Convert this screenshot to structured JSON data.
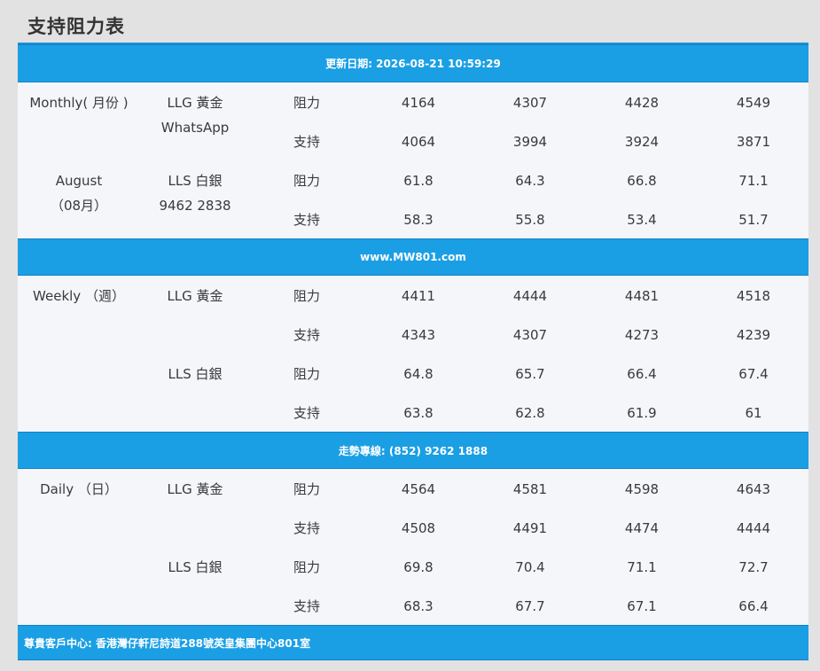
{
  "title": "支持阻力表",
  "banners": {
    "updated": "更新日期: 2026-08-21 10:59:29",
    "website": "www.MW801.com",
    "hotline": "走勢專線: (852) 9262 1888",
    "footer": "尊貴客戶中心: 香港灣仔軒尼詩道288號英皇集團中心801室"
  },
  "monthly": {
    "period_line1": "Monthly( 月份 )",
    "period_line2": "August",
    "period_line3": "（08月）",
    "gold_label": "LLG 黃金",
    "gold_sub": "WhatsApp",
    "silver_label": "LLS 白銀",
    "silver_sub": "9462 2838",
    "rows": [
      {
        "kind": "阻力",
        "values": [
          "4164",
          "4307",
          "4428",
          "4549"
        ]
      },
      {
        "kind": "支持",
        "values": [
          "4064",
          "3994",
          "3924",
          "3871"
        ]
      },
      {
        "kind": "阻力",
        "values": [
          "61.8",
          "64.3",
          "66.8",
          "71.1"
        ]
      },
      {
        "kind": "支持",
        "values": [
          "58.3",
          "55.8",
          "53.4",
          "51.7"
        ]
      }
    ]
  },
  "weekly": {
    "period": "Weekly （週）",
    "gold_label": "LLG 黃金",
    "silver_label": "LLS 白銀",
    "rows": [
      {
        "kind": "阻力",
        "values": [
          "4411",
          "4444",
          "4481",
          "4518"
        ]
      },
      {
        "kind": "支持",
        "values": [
          "4343",
          "4307",
          "4273",
          "4239"
        ]
      },
      {
        "kind": "阻力",
        "values": [
          "64.8",
          "65.7",
          "66.4",
          "67.4"
        ]
      },
      {
        "kind": "支持",
        "values": [
          "63.8",
          "62.8",
          "61.9",
          "61"
        ]
      }
    ]
  },
  "daily": {
    "period": "Daily （日）",
    "gold_label": "LLG 黃金",
    "silver_label": "LLS 白銀",
    "rows": [
      {
        "kind": "阻力",
        "values": [
          "4564",
          "4581",
          "4598",
          "4643"
        ]
      },
      {
        "kind": "支持",
        "values": [
          "4508",
          "4491",
          "4474",
          "4444"
        ]
      },
      {
        "kind": "阻力",
        "values": [
          "69.8",
          "70.4",
          "71.1",
          "72.7"
        ]
      },
      {
        "kind": "支持",
        "values": [
          "68.3",
          "67.7",
          "67.1",
          "66.4"
        ]
      }
    ]
  },
  "colors": {
    "banner": "#1a9fe5",
    "table_bg": "#f5f6fa",
    "page_bg": "#e2e2e2"
  }
}
